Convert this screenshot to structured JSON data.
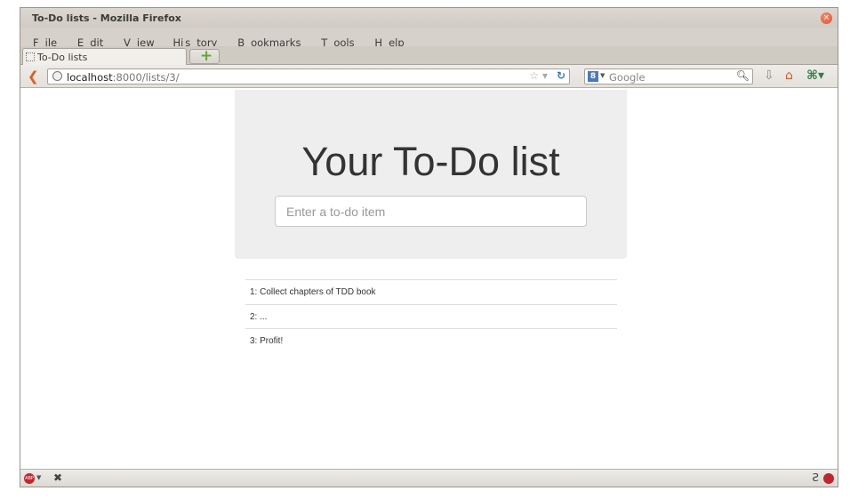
{
  "window": {
    "title": "To-Do lists - Mozilla Firefox"
  },
  "menu": {
    "items": [
      {
        "pre": "",
        "u": "F",
        "post": "ile"
      },
      {
        "pre": "",
        "u": "E",
        "post": "dit"
      },
      {
        "pre": "",
        "u": "V",
        "post": "iew"
      },
      {
        "pre": "Hi",
        "u": "s",
        "post": "tory"
      },
      {
        "pre": "",
        "u": "B",
        "post": "ookmarks"
      },
      {
        "pre": "",
        "u": "T",
        "post": "ools"
      },
      {
        "pre": "",
        "u": "H",
        "post": "elp"
      }
    ]
  },
  "tabs": [
    {
      "label": "To-Do lists"
    }
  ],
  "nav": {
    "url_host": "localhost",
    "url_path": ":8000/lists/3/",
    "search_placeholder": "Google"
  },
  "page": {
    "heading": "Your To-Do list",
    "input_placeholder": "Enter a to-do item",
    "items": [
      "1: Collect chapters of TDD book",
      "2: ...",
      "3: Profit!"
    ]
  },
  "colors": {
    "accent_back": "#e05b1b",
    "jumbotron_bg": "#eeeeee"
  },
  "icons": [
    "back-icon",
    "globe-icon",
    "bookmark-star-icon",
    "reload-icon",
    "google-icon",
    "search-icon",
    "download-icon",
    "home-icon",
    "addon-icon",
    "adblock-icon",
    "close-x-icon",
    "s-icon",
    "stop-icon"
  ]
}
